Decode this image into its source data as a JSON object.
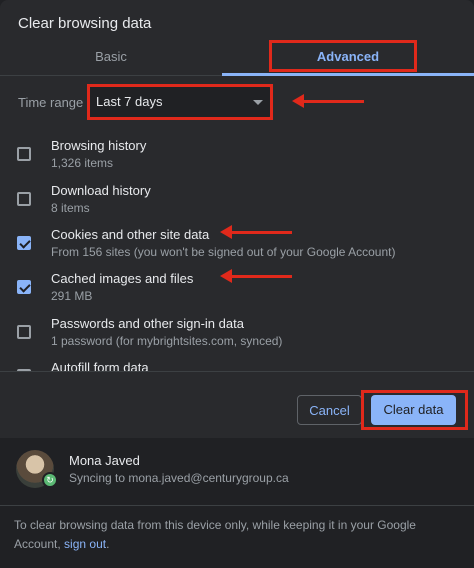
{
  "dialog": {
    "title": "Clear browsing data",
    "tabs": [
      {
        "label": "Basic",
        "active": false
      },
      {
        "label": "Advanced",
        "active": true
      }
    ]
  },
  "time_range": {
    "label": "Time range",
    "selected": "Last 7 days"
  },
  "items": [
    {
      "title": "Browsing history",
      "subtitle": "1,326 items",
      "checked": false
    },
    {
      "title": "Download history",
      "subtitle": "8 items",
      "checked": false
    },
    {
      "title": "Cookies and other site data",
      "subtitle": "From 156 sites (you won't be signed out of your Google Account)",
      "checked": true
    },
    {
      "title": "Cached images and files",
      "subtitle": "291 MB",
      "checked": true
    },
    {
      "title": "Passwords and other sign-in data",
      "subtitle": "1 password (for mybrightsites.com, synced)",
      "checked": false
    },
    {
      "title": "Autofill form data",
      "subtitle": "",
      "checked": false
    }
  ],
  "buttons": {
    "cancel": "Cancel",
    "clear": "Clear data"
  },
  "account": {
    "name": "Mona Javed",
    "sync": "Syncing to mona.javed@centurygroup.ca"
  },
  "footer": {
    "text": "To clear browsing data from this device only, while keeping it in your Google Account,",
    "link": "sign out",
    "end": "."
  },
  "colors": {
    "accent": "#8ab4f8",
    "background": "#292a2d",
    "annotation": "#e0291b"
  }
}
